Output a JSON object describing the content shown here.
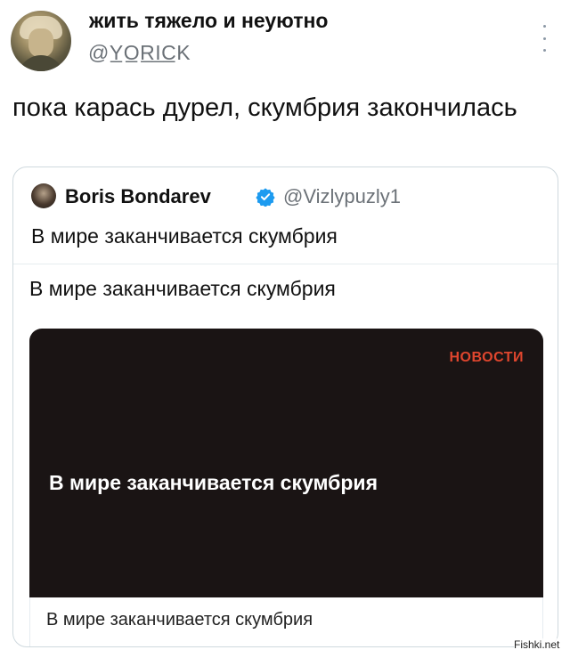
{
  "author": {
    "display_name": "жить тяжело и неуютно",
    "handle": "@Y̲O̲R̲I̲C̲K"
  },
  "tweet": {
    "text": "пока карась дурел, скумбрия закончилась"
  },
  "quoted": {
    "display_name": "Boris Bondarev",
    "handle": "@Vizlypuzly1",
    "text": "В мире заканчивается скумбрия",
    "link_card": {
      "title": "В мире заканчивается скумбрия",
      "image_tag": "НОВОСТИ",
      "image_headline": "В мире заканчивается скумбрия",
      "caption": "В мире заканчивается скумбрия"
    }
  },
  "watermark": "Fishki.net",
  "icons": {
    "verified": "verified-badge-icon",
    "more": "more-options-icon"
  },
  "colors": {
    "verified_blue": "#1d9bf0",
    "news_tag": "#e0462e",
    "image_bg": "#1a1414"
  }
}
